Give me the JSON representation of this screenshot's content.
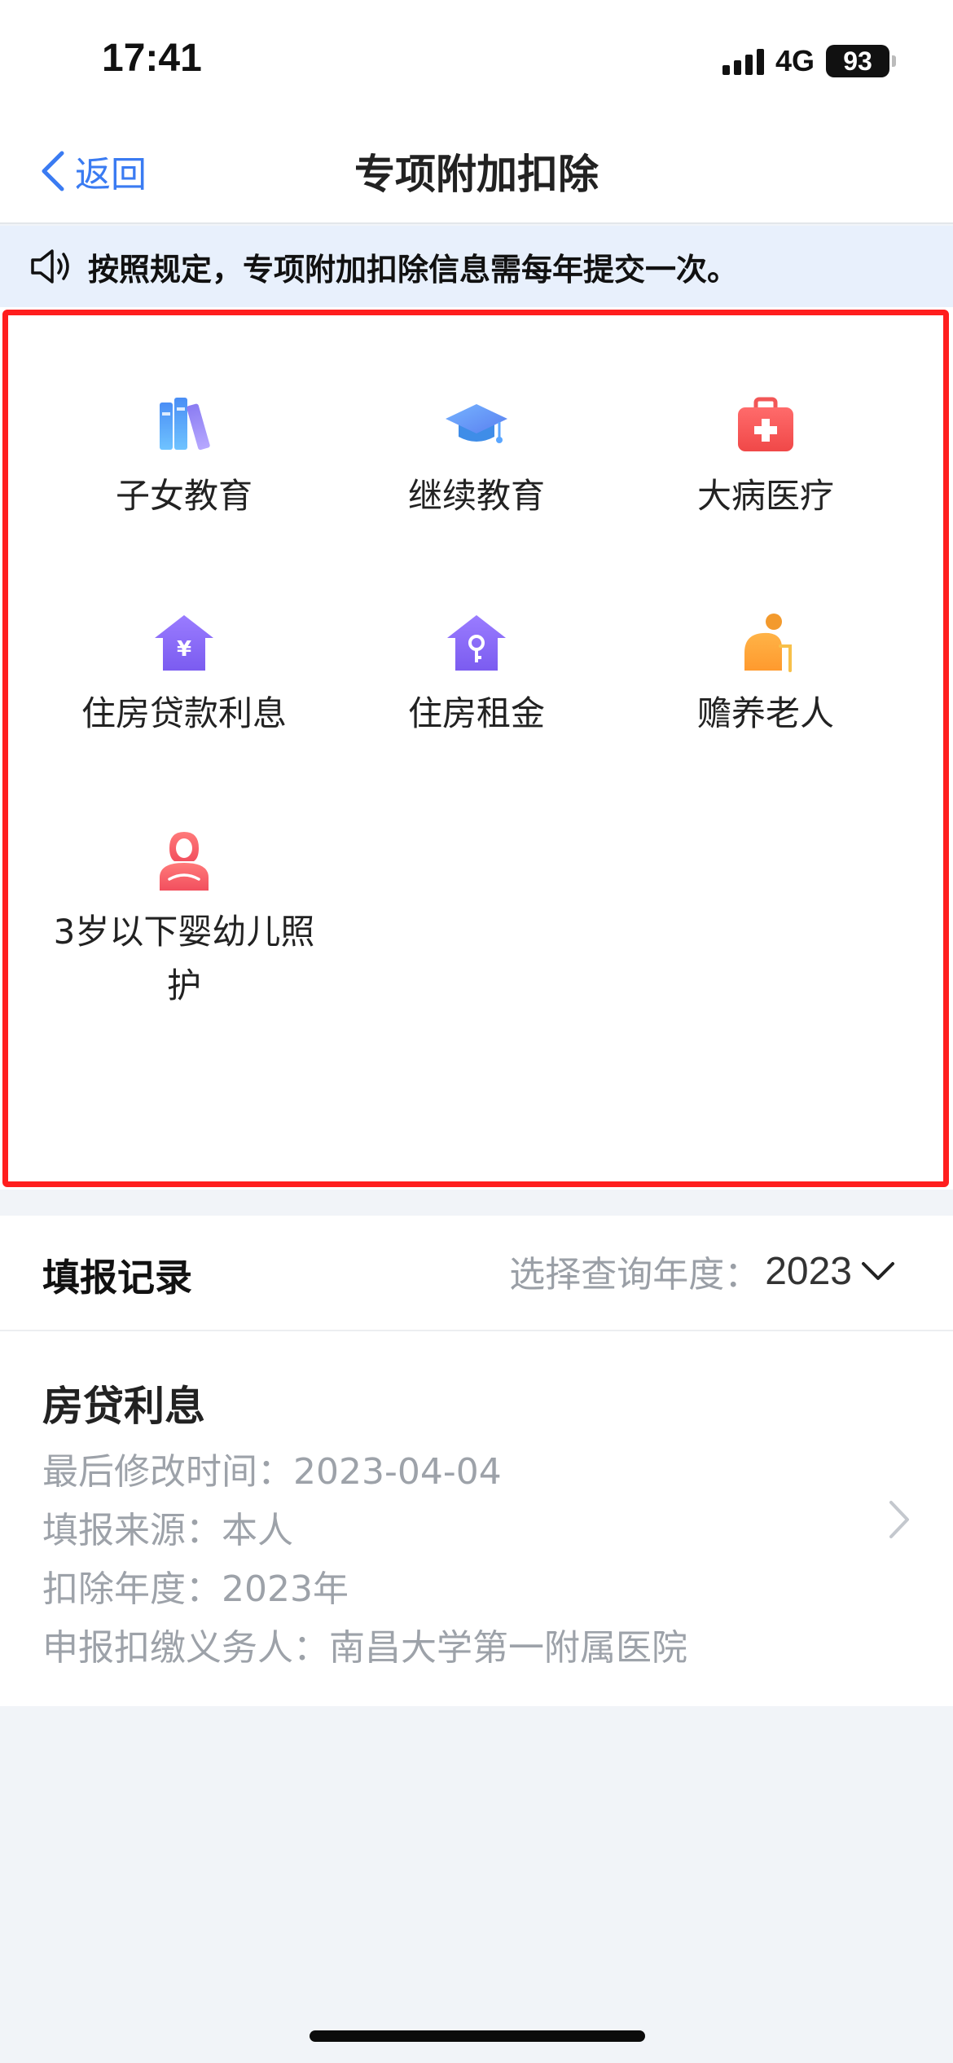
{
  "status_bar": {
    "time": "17:41",
    "network": "4G",
    "battery": "93"
  },
  "nav": {
    "back_label": "返回",
    "title": "专项附加扣除"
  },
  "notice": {
    "text": "按照规定，专项附加扣除信息需每年提交一次。"
  },
  "categories": [
    {
      "label": "子女教育",
      "icon": "books-icon"
    },
    {
      "label": "继续教育",
      "icon": "graduation-cap-icon"
    },
    {
      "label": "大病医疗",
      "icon": "medical-kit-icon"
    },
    {
      "label": "住房贷款利息",
      "icon": "house-yuan-icon"
    },
    {
      "label": "住房租金",
      "icon": "house-key-icon"
    },
    {
      "label": "赡养老人",
      "icon": "elderly-person-icon"
    },
    {
      "label": "3岁以下婴幼儿照护",
      "icon": "mother-baby-icon"
    }
  ],
  "records": {
    "title": "填报记录",
    "year_label": "选择查询年度：",
    "year_value": "2023",
    "items": [
      {
        "title": "房贷利息",
        "modified": "最后修改时间：2023-04-04",
        "source": "填报来源：本人",
        "year": "扣除年度：2023年",
        "withholder": "申报扣缴义务人：南昌大学第一附属医院"
      }
    ]
  },
  "colors": {
    "accent": "#3a7bf2",
    "highlight_frame": "#ff1e1e",
    "notice_bg": "#e8f0fc"
  }
}
